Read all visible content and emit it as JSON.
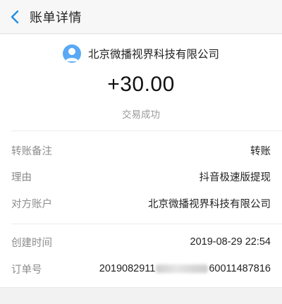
{
  "header": {
    "title": "账单详情"
  },
  "merchant": {
    "name": "北京微播视界科技有限公司"
  },
  "transaction": {
    "amount": "+30.00",
    "status": "交易成功"
  },
  "details": [
    {
      "label": "转账备注",
      "value": "转账"
    },
    {
      "label": "理由",
      "value": "抖音极速版提现"
    },
    {
      "label": "对方账户",
      "value": "北京微播视界科技有限公司"
    }
  ],
  "meta": {
    "created_label": "创建时间",
    "created_value": "2019-08-29 22:54",
    "order_label": "订单号",
    "order_prefix": "2019082911",
    "order_suffix": "60011487816"
  },
  "colors": {
    "accent": "#1e8ee6",
    "avatar": "#5aa9f4"
  }
}
